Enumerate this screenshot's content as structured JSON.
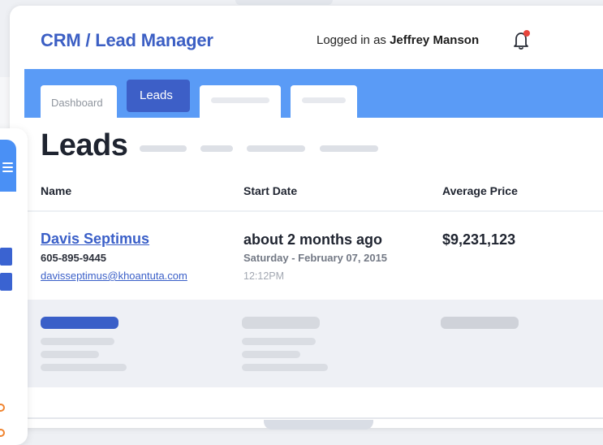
{
  "header": {
    "app_title": "CRM / Lead Manager",
    "logged_in_prefix": "Logged in as",
    "user_name": "Jeffrey Manson",
    "notification_icon": "bell-icon",
    "notification_dot_color": "#e8453c"
  },
  "nav": {
    "tabs": [
      {
        "label": "Dashboard",
        "active": false
      },
      {
        "label": "Leads",
        "active": true
      }
    ],
    "accent_color": "#5a9bf6",
    "active_tab_color": "#3d5fc7"
  },
  "page": {
    "title": "Leads"
  },
  "table": {
    "columns": [
      "Name",
      "Start Date",
      "Average Price"
    ],
    "rows": [
      {
        "name": "Davis Septimus",
        "phone": "605-895-9445",
        "email": "davisseptimus@khoantuta.com",
        "start_relative": "about 2 months ago",
        "start_date": "Saturday - February 07, 2015",
        "start_time": "12:12PM",
        "average_price": "$9,231,123"
      }
    ]
  },
  "sidebar": {
    "menu_icon": "hamburger-icon"
  }
}
